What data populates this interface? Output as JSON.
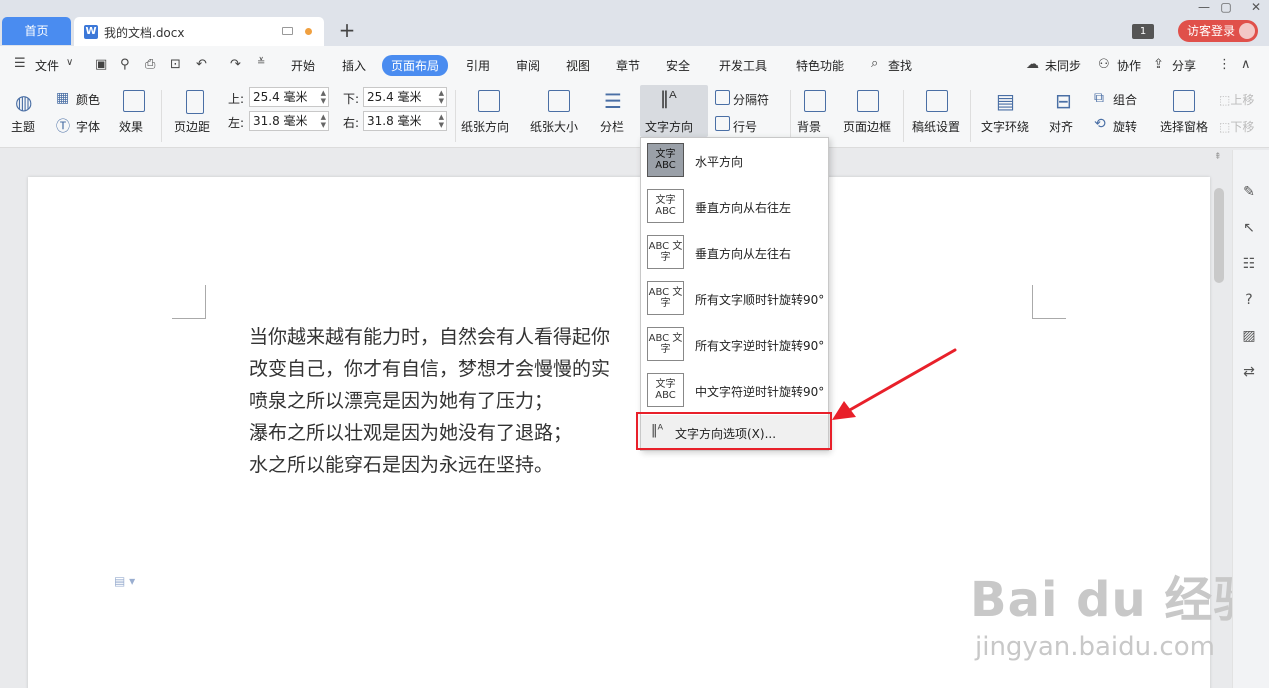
{
  "titlebar": {
    "home_tab": "首页",
    "doc_tab": "我的文档.docx",
    "add_tab": "+",
    "window_count": "1",
    "login": "访客登录",
    "controls": [
      "—",
      "▢",
      "✕"
    ]
  },
  "menubar": {
    "file": "文件",
    "tabs": [
      "开始",
      "插入",
      "页面布局",
      "引用",
      "审阅",
      "视图",
      "章节",
      "安全",
      "开发工具",
      "特色功能"
    ],
    "active_tab": "页面布局",
    "search": "查找",
    "sync": "未同步",
    "collab": "协作",
    "share": "分享"
  },
  "ribbon": {
    "theme": "主题",
    "color": "颜色",
    "font": "字体",
    "effect": "效果",
    "margin": "页边距",
    "top_label": "上:",
    "top_value": "25.4 毫米",
    "bottom_label": "下:",
    "bottom_value": "25.4 毫米",
    "left_label": "左:",
    "left_value": "31.8 毫米",
    "right_label": "右:",
    "right_value": "31.8 毫米",
    "orientation": "纸张方向",
    "paper_size": "纸张大小",
    "columns": "分栏",
    "text_direction": "文字方向",
    "breaks": "分隔符",
    "line_numbers": "行号",
    "background": "背景",
    "page_border": "页面边框",
    "grid_paper": "稿纸设置",
    "text_wrap": "文字环绕",
    "align": "对齐",
    "group": "组合",
    "rotate": "旋转",
    "selection_pane": "选择窗格",
    "move_up": "上移",
    "move_down": "下移"
  },
  "document": {
    "lines": [
      "当你越来越有能力时，自然会有人看得起你",
      "改变自己，你才有自信，梦想才会慢慢的实",
      "喷泉之所以漂亮是因为她有了压力；",
      "瀑布之所以壮观是因为她没有了退路；",
      "水之所以能穿石是因为永远在坚持。"
    ]
  },
  "dropdown": {
    "items": [
      {
        "label": "水平方向",
        "thumb": "文字 ABC"
      },
      {
        "label": "垂直方向从右往左",
        "thumb": "文字 ABC"
      },
      {
        "label": "垂直方向从左往右",
        "thumb": "ABC 文字"
      },
      {
        "label": "所有文字顺时针旋转90°",
        "thumb": "ABC 文字"
      },
      {
        "label": "所有文字逆时针旋转90°",
        "thumb": "ABC 文字"
      },
      {
        "label": "中文字符逆时针旋转90°",
        "thumb": "文字 ABC"
      }
    ],
    "options": "文字方向选项(X)..."
  },
  "watermark": {
    "brand": "Bai du 经验",
    "url": "jingyan.baidu.com"
  },
  "colors": {
    "accent": "#4a8cf0",
    "login": "#e0504a",
    "highlight": "#e8202a"
  }
}
